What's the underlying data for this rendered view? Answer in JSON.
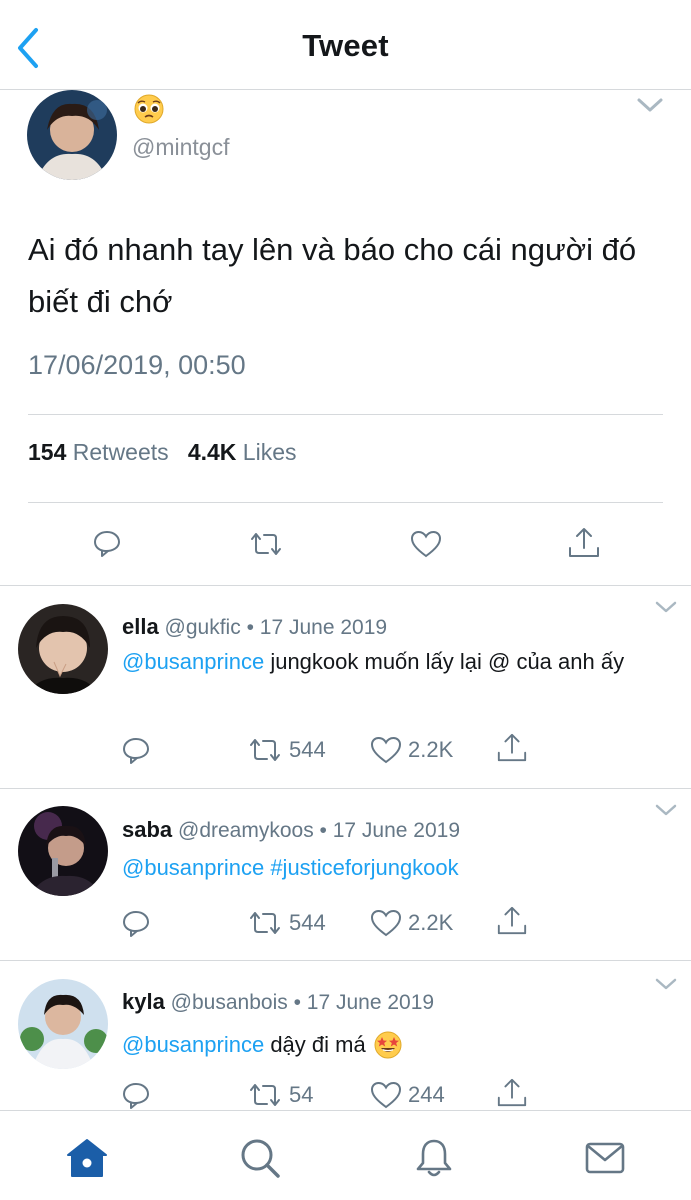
{
  "header": {
    "title": "Tweet"
  },
  "main_tweet": {
    "handle": "@mintgcf",
    "text": "Ai đó nhanh tay lên và báo cho cái người đó biết đi chớ",
    "date": "17/06/2019, 00:50",
    "retweets_count": "154",
    "retweets_label": "Retweets",
    "likes_count": "4.4K",
    "likes_label": "Likes"
  },
  "replies": [
    {
      "name": "ella",
      "handle": "@gukfic",
      "date": "• 17 June 2019",
      "mention": "@busanprince",
      "text": " jungkook muốn lấy lại @ của anh ấy",
      "retweets": "544",
      "likes": "2.2K"
    },
    {
      "name": "saba",
      "handle": "@dreamykoos",
      "date": "• 17 June 2019",
      "mention": "@busanprince",
      "hashtag": " #justiceforjungkook",
      "retweets": "544",
      "likes": "2.2K"
    },
    {
      "name": "kyla",
      "handle": "@busanbois",
      "date": "• 17 June 2019",
      "mention": "@busanprince",
      "text": " dậy đi má",
      "retweets": "54",
      "likes": "244"
    }
  ],
  "colors": {
    "accent": "#1da1f2",
    "muted": "#657786",
    "divider": "#d6d9dc",
    "home_active": "#1b5ea8"
  },
  "icons": {
    "back": "chevron-left-icon",
    "caret": "chevron-down-icon",
    "reply": "comment-icon",
    "retweet": "retweet-icon",
    "like": "heart-icon",
    "share": "share-icon",
    "home": "home-icon",
    "search": "search-icon",
    "notifications": "bell-icon",
    "messages": "mail-icon"
  }
}
